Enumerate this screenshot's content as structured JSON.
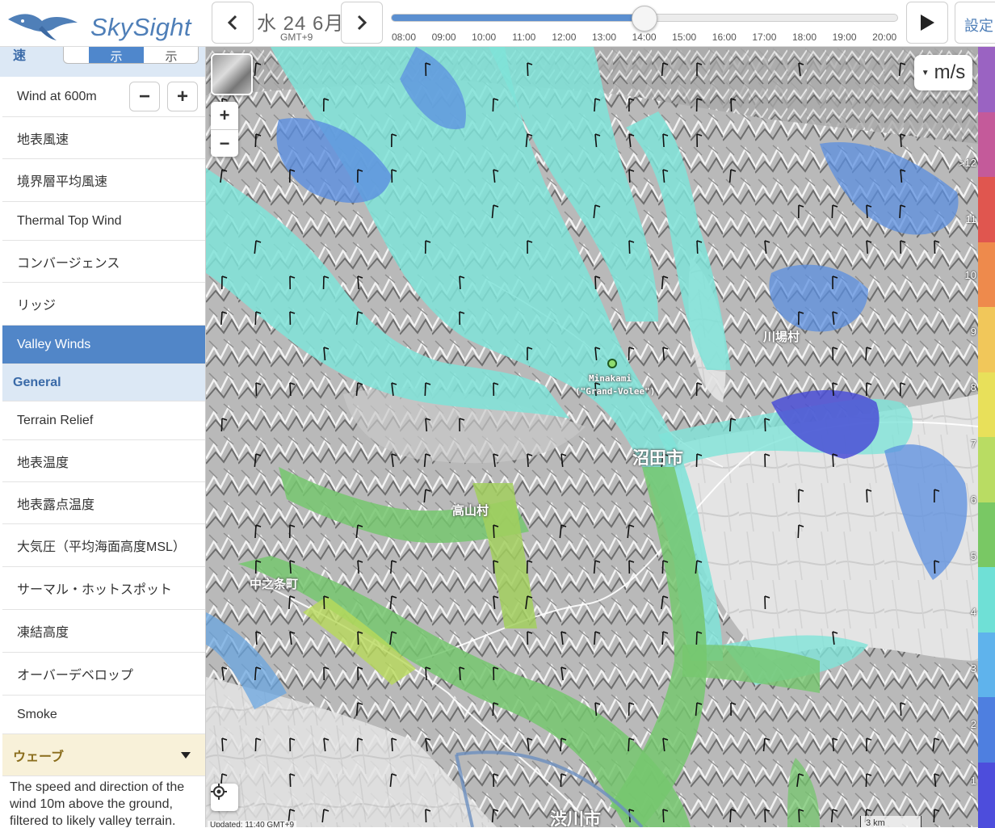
{
  "header": {
    "app_name": "SkySight",
    "date_label": "水 24 6月",
    "timezone": "GMT+9",
    "times": [
      "08:00",
      "09:00",
      "10:00",
      "11:00",
      "12:00",
      "13:00",
      "14:00",
      "15:00",
      "16:00",
      "17:00",
      "18:00",
      "19:00",
      "20:00"
    ],
    "selected_time": "14:00",
    "settings_label": "設定"
  },
  "sidebar": {
    "toggle": {
      "label": "速",
      "on_label": "示",
      "off_label": "示"
    },
    "wind_level_label": "Wind at 600m",
    "minus_label": "−",
    "plus_label": "+",
    "items": [
      {
        "label": "地表風速"
      },
      {
        "label": "境界層平均風速"
      },
      {
        "label": "Thermal Top Wind"
      },
      {
        "label": "コンバージェンス"
      },
      {
        "label": "リッジ"
      },
      {
        "label": "Valley Winds",
        "active": true
      }
    ],
    "general_header": "General",
    "general_items": [
      {
        "label": "Terrain Relief"
      },
      {
        "label": "地表温度"
      },
      {
        "label": "地表露点温度"
      },
      {
        "label": "大気圧（平均海面高度MSL）"
      },
      {
        "label": "サーマル・ホットスポット"
      },
      {
        "label": "凍結高度"
      },
      {
        "label": "オーバーデベロップ"
      },
      {
        "label": "Smoke"
      }
    ],
    "wave_section": "ウェーブ",
    "description": "The speed and direction of the wind 10m above the ground, filtered to likely valley terrain."
  },
  "map": {
    "unit": "m/s",
    "zoom_in": "+",
    "zoom_out": "−",
    "places": [
      {
        "name": "沼田市"
      },
      {
        "name": "高山村"
      },
      {
        "name": "中之条町"
      },
      {
        "name": "川場村"
      },
      {
        "name": "渋川市"
      }
    ],
    "marker": {
      "name": "Minakami",
      "subname": "(\"Grand-Volee\")"
    },
    "updated": "Updated: 11:40 GMT+9",
    "scale": "3 km"
  },
  "legend": {
    "labels": [
      ">12",
      "11",
      "10",
      "9",
      "8",
      "7",
      "6",
      "5",
      "4",
      "3",
      "2",
      "1"
    ],
    "colors": [
      "#9a63c2",
      "#c45a9a",
      "#e0564f",
      "#ee8a4c",
      "#f1c75a",
      "#e8e05a",
      "#b9dc63",
      "#79c864",
      "#6fe0d6",
      "#5fb3ec",
      "#4e7fe0",
      "#4d4ddc"
    ]
  }
}
